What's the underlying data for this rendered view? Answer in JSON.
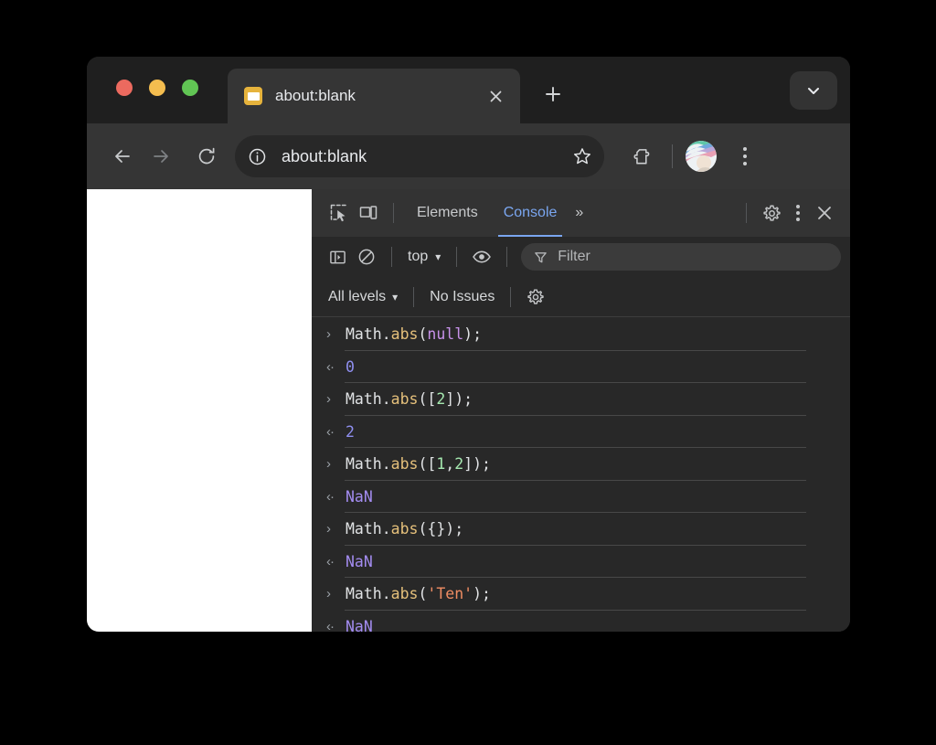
{
  "browser": {
    "tab": {
      "title": "about:blank",
      "favicon_icon": "default-page-icon",
      "close_icon": "close-icon"
    },
    "new_tab_icon": "plus-icon",
    "tab_search_icon": "chevron-down-icon",
    "toolbar": {
      "back_icon": "arrow-left-icon",
      "forward_icon": "arrow-right-icon",
      "reload_icon": "reload-icon",
      "site_info_icon": "info-circle-icon",
      "url": "about:blank",
      "bookmark_icon": "star-icon",
      "extensions_icon": "puzzle-piece-icon",
      "avatar_icon": "profile-avatar",
      "menu_icon": "kebab-menu-icon"
    }
  },
  "devtools": {
    "inspect_icon": "inspect-element-icon",
    "device_toolbar_icon": "device-toggle-icon",
    "tabs": [
      {
        "label": "Elements",
        "active": false
      },
      {
        "label": "Console",
        "active": true
      }
    ],
    "more_tabs_label": "»",
    "settings_icon": "gear-icon",
    "kebab_icon": "kebab-menu-icon",
    "close_icon": "close-icon",
    "console_toolbar": {
      "sidebar_toggle_icon": "sidebar-toggle-icon",
      "clear_console_icon": "clear-console-icon",
      "context_label": "top",
      "context_caret": "▾",
      "live_expression_icon": "eye-icon",
      "filter_icon": "filter-funnel-icon",
      "filter_value": "",
      "filter_placeholder": "Filter"
    },
    "console_toolbar2": {
      "levels_label": "All levels",
      "levels_caret": "▾",
      "issues_label": "No Issues",
      "settings_icon": "gear-icon"
    },
    "console_log": [
      {
        "kind": "input",
        "arrow": "›",
        "tokens": [
          {
            "t": "Math.",
            "c": "tok-plain"
          },
          {
            "t": "abs",
            "c": "tok-fn"
          },
          {
            "t": "(",
            "c": "tok-plain"
          },
          {
            "t": "null",
            "c": "tok-kw"
          },
          {
            "t": ");",
            "c": "tok-plain"
          }
        ]
      },
      {
        "kind": "output",
        "arrow": "‹·",
        "tokens": [
          {
            "t": "0",
            "c": "val-num"
          }
        ]
      },
      {
        "kind": "input",
        "arrow": "›",
        "tokens": [
          {
            "t": "Math.",
            "c": "tok-plain"
          },
          {
            "t": "abs",
            "c": "tok-fn"
          },
          {
            "t": "([",
            "c": "tok-plain"
          },
          {
            "t": "2",
            "c": "tok-num"
          },
          {
            "t": "]);",
            "c": "tok-plain"
          }
        ]
      },
      {
        "kind": "output",
        "arrow": "‹·",
        "tokens": [
          {
            "t": "2",
            "c": "val-num"
          }
        ]
      },
      {
        "kind": "input",
        "arrow": "›",
        "tokens": [
          {
            "t": "Math.",
            "c": "tok-plain"
          },
          {
            "t": "abs",
            "c": "tok-fn"
          },
          {
            "t": "([",
            "c": "tok-plain"
          },
          {
            "t": "1",
            "c": "tok-num"
          },
          {
            "t": ",",
            "c": "tok-plain"
          },
          {
            "t": "2",
            "c": "tok-num"
          },
          {
            "t": "]);",
            "c": "tok-plain"
          }
        ]
      },
      {
        "kind": "output",
        "arrow": "‹·",
        "tokens": [
          {
            "t": "NaN",
            "c": "val-nan"
          }
        ]
      },
      {
        "kind": "input",
        "arrow": "›",
        "tokens": [
          {
            "t": "Math.",
            "c": "tok-plain"
          },
          {
            "t": "abs",
            "c": "tok-fn"
          },
          {
            "t": "({});",
            "c": "tok-plain"
          }
        ]
      },
      {
        "kind": "output",
        "arrow": "‹·",
        "tokens": [
          {
            "t": "NaN",
            "c": "val-nan"
          }
        ]
      },
      {
        "kind": "input",
        "arrow": "›",
        "tokens": [
          {
            "t": "Math.",
            "c": "tok-plain"
          },
          {
            "t": "abs",
            "c": "tok-fn"
          },
          {
            "t": "(",
            "c": "tok-plain"
          },
          {
            "t": "'Ten'",
            "c": "tok-str"
          },
          {
            "t": ");",
            "c": "tok-plain"
          }
        ]
      },
      {
        "kind": "output",
        "arrow": "‹·",
        "tokens": [
          {
            "t": "NaN",
            "c": "val-nan"
          }
        ]
      }
    ]
  },
  "colors": {
    "accent_tab_active": "#7aa6f0",
    "window_bg": "#282828",
    "tabstrip_bg": "#1f1f1f",
    "toolbar_bg": "#353535",
    "favicon": "#e6b33c",
    "traffic_red": "#ec6a5f",
    "traffic_yellow": "#f4bd4f",
    "traffic_green": "#61c554"
  }
}
